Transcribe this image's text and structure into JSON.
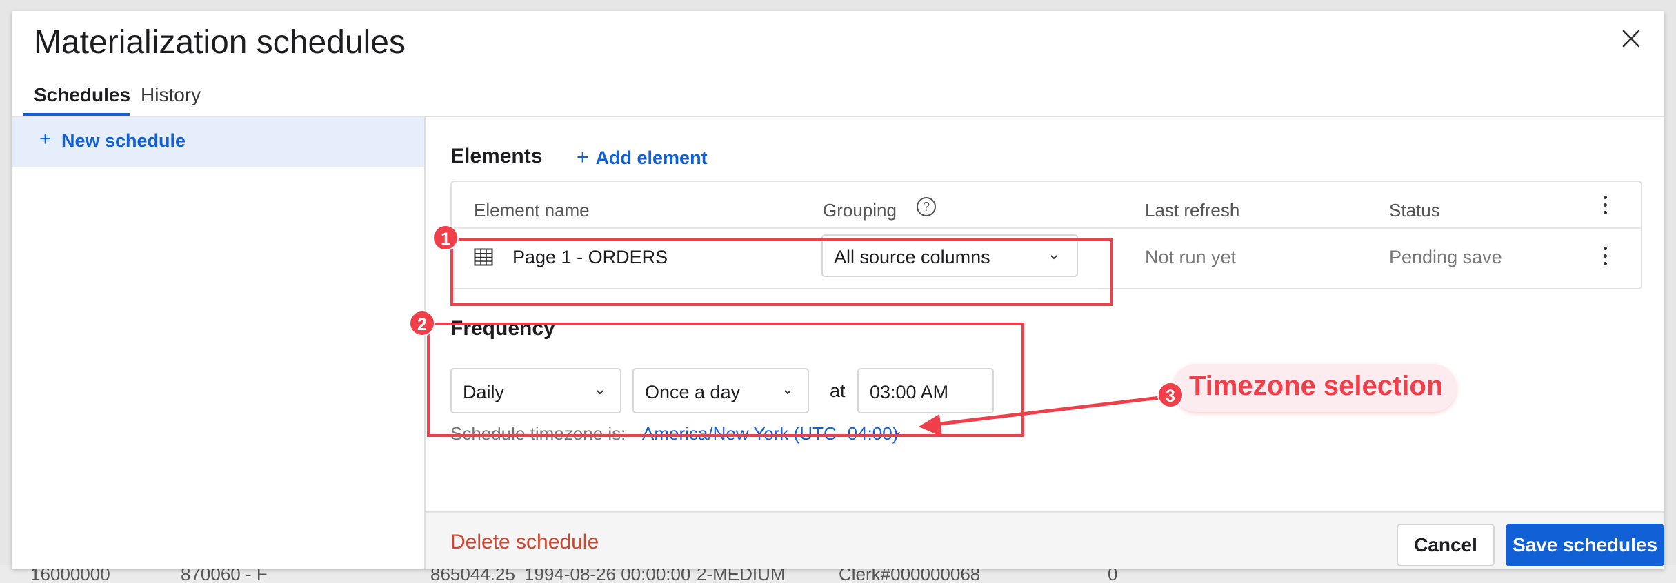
{
  "dialog": {
    "title": "Materialization schedules",
    "tabs": [
      {
        "label": "Schedules",
        "active": true
      },
      {
        "label": "History",
        "active": false
      }
    ]
  },
  "sidebar": {
    "new_schedule_label": "New schedule",
    "plus": "+"
  },
  "elements": {
    "title": "Elements",
    "add_label": "Add element",
    "plus": "+",
    "columns": [
      "Element name",
      "Grouping",
      "Last refresh",
      "Status"
    ],
    "help_glyph": "?",
    "rows": [
      {
        "name": "Page 1 - ORDERS",
        "grouping": "All source columns",
        "last_refresh": "Not run yet",
        "status": "Pending save"
      }
    ]
  },
  "frequency": {
    "title": "Frequency",
    "period": "Daily",
    "times_per_period": "Once a day",
    "at_label": "at",
    "time": "03:00 AM",
    "timezone_prefix": "Schedule timezone is:",
    "timezone": "America/New York (UTC -04:00)"
  },
  "footer": {
    "delete_label": "Delete schedule",
    "cancel_label": "Cancel",
    "save_label": "Save schedules"
  },
  "annotations": {
    "badges": [
      "1",
      "2",
      "3"
    ],
    "callout": "Timezone selection",
    "color": "#ef3f4a"
  },
  "background_row": [
    "16000000",
    "870060 - F",
    "865044.25",
    "1994-08-26 00:00:00",
    "2-MEDIUM",
    "Clerk#000000068",
    "0"
  ],
  "colors": {
    "accent": "#1160d6",
    "danger": "#d3452f",
    "selected_bg": "#e6eefc"
  }
}
